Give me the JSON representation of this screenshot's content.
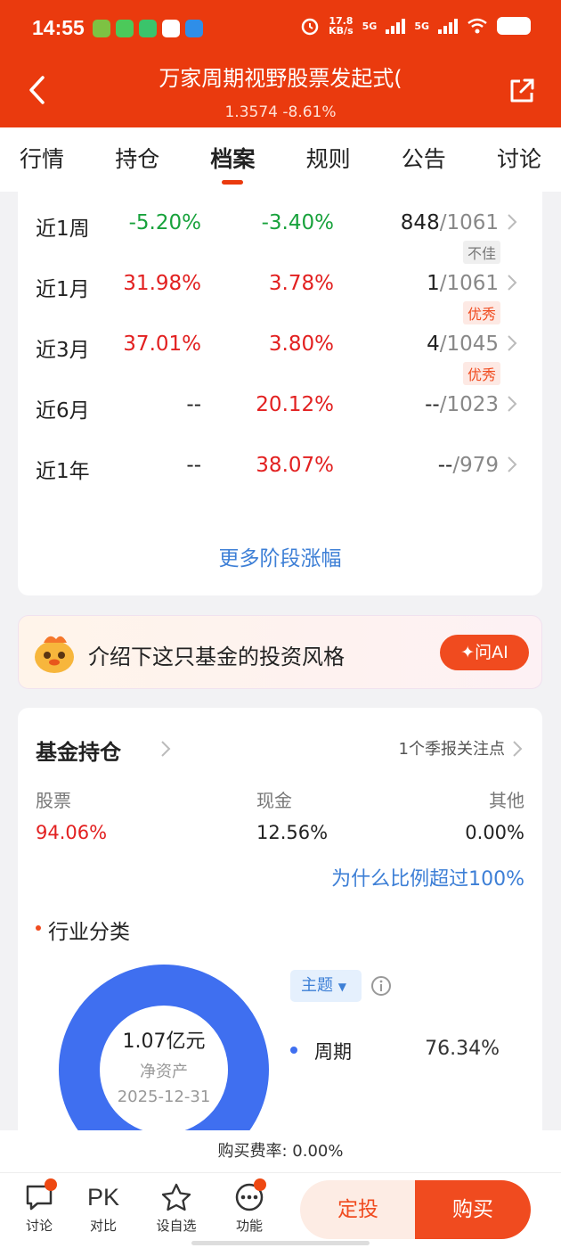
{
  "status_bar": {
    "time": "14:55",
    "net_speed": "17.8",
    "net_speed_unit": "KB/s",
    "sim1": "5G",
    "sim2": "5G"
  },
  "header": {
    "title": "万家周期视野股票发起式(",
    "subtitle": "1.3574 -8.61%",
    "bg_color": "#ea3a0e"
  },
  "tabs": [
    {
      "label": "行情",
      "active": false
    },
    {
      "label": "持仓",
      "active": false
    },
    {
      "label": "档案",
      "active": true
    },
    {
      "label": "规则",
      "active": false
    },
    {
      "label": "公告",
      "active": false
    },
    {
      "label": "讨论",
      "active": false
    }
  ],
  "performance": {
    "rows": [
      {
        "period": "近1周",
        "change": "-5.20%",
        "avg": "-3.40%",
        "rank": "848",
        "total": "/1061",
        "tag": "不佳"
      },
      {
        "period": "近1月",
        "change": "31.98%",
        "avg": "3.78%",
        "rank": "1",
        "total": "/1061",
        "tag": "优秀"
      },
      {
        "period": "近3月",
        "change": "37.01%",
        "avg": "3.80%",
        "rank": "4",
        "total": "/1045",
        "tag": "优秀"
      },
      {
        "period": "近6月",
        "change": "--",
        "avg": "20.12%",
        "rank": "--",
        "total": "/1023",
        "tag": ""
      },
      {
        "period": "近1年",
        "change": "--",
        "avg": "38.07%",
        "rank": "--",
        "total": "/979",
        "tag": ""
      }
    ],
    "more_link": "更多阶段涨幅"
  },
  "ai_banner": {
    "text": "介绍下这只基金的投资风格",
    "button": "问AI"
  },
  "holdings": {
    "title": "基金持仓",
    "right_link": "1个季报关注点",
    "allocation": [
      {
        "label": "股票",
        "value": "94.06%"
      },
      {
        "label": "现金",
        "value": "12.56%"
      },
      {
        "label": "其他",
        "value": "0.00%"
      }
    ],
    "why_link": "为什么比例超过100%",
    "industry_title": "行业分类",
    "donut": {
      "amount": "1.07亿元",
      "caption": "净资产",
      "date": "2025-12-31"
    },
    "theme_button": "主题",
    "legend": [
      {
        "name": "周期",
        "value": "76.34%",
        "color": "#3f6ff0"
      }
    ]
  },
  "fee": {
    "text": "购买费率: 0.00%"
  },
  "bottom_nav": {
    "items": [
      {
        "label": "讨论"
      },
      {
        "label": "对比",
        "glyph": "PK"
      },
      {
        "label": "设自选"
      },
      {
        "label": "功能"
      }
    ],
    "dingtou": "定投",
    "buy": "购买"
  }
}
